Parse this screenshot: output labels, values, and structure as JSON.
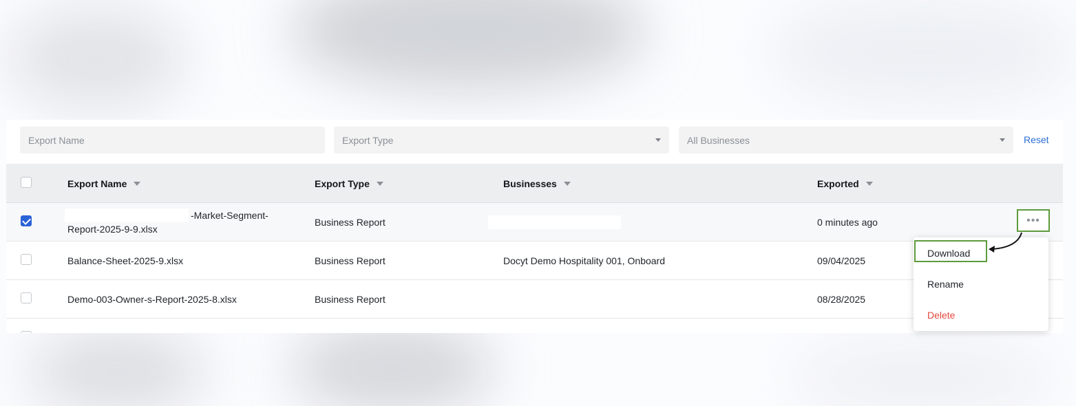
{
  "filters": {
    "export_name_placeholder": "Export Name",
    "export_type_placeholder": "Export Type",
    "businesses_placeholder": "All Businesses",
    "reset_label": "Reset"
  },
  "table": {
    "headers": {
      "export_name": "Export Name",
      "export_type": "Export Type",
      "businesses": "Businesses",
      "exported": "Exported"
    },
    "rows": [
      {
        "name_line1": "-Market-Segment-",
        "name_line2": "Report-2025-9-9.xlsx",
        "type": "Business Report",
        "businesses": "",
        "exported": "0 minutes ago",
        "checked": true
      },
      {
        "name": "Balance-Sheet-2025-9.xlsx",
        "type": "Business Report",
        "businesses": "Docyt Demo Hospitality 001, Onboard",
        "exported": "09/04/2025",
        "checked": false
      },
      {
        "name": "Demo-003-Owner-s-Report-2025-8.xlsx",
        "type": "Business Report",
        "businesses": "",
        "exported": "08/28/2025",
        "checked": false
      }
    ]
  },
  "row_menu": {
    "trigger_label": "•••",
    "items": [
      "Download",
      "Rename",
      "Delete"
    ]
  },
  "colors": {
    "accent": "#2a62d8",
    "highlight": "#5d9a3c",
    "danger": "#e4473d"
  }
}
